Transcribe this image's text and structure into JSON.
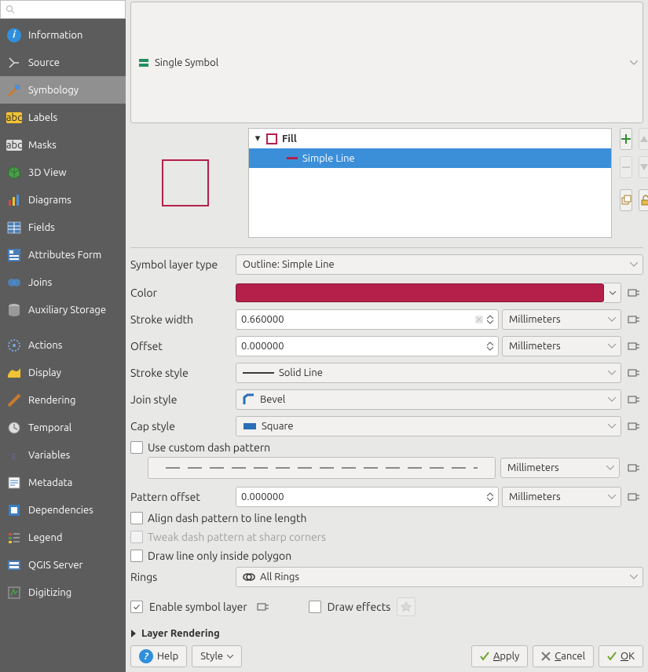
{
  "sidebar": {
    "search_placeholder": "",
    "items": [
      {
        "label": "Information",
        "icon": "info-icon",
        "selected": false
      },
      {
        "label": "Source",
        "icon": "source-icon",
        "selected": false
      },
      {
        "label": "Symbology",
        "icon": "symbology-icon",
        "selected": true
      },
      {
        "label": "Labels",
        "icon": "labels-icon",
        "selected": false
      },
      {
        "label": "Masks",
        "icon": "masks-icon",
        "selected": false
      },
      {
        "label": "3D View",
        "icon": "3d-view-icon",
        "selected": false
      },
      {
        "label": "Diagrams",
        "icon": "diagrams-icon",
        "selected": false
      },
      {
        "label": "Fields",
        "icon": "fields-icon",
        "selected": false
      },
      {
        "label": "Attributes Form",
        "icon": "attributes-form-icon",
        "selected": false
      },
      {
        "label": "Joins",
        "icon": "joins-icon",
        "selected": false
      },
      {
        "label": "Auxiliary Storage",
        "icon": "auxiliary-storage-icon",
        "selected": false
      },
      {
        "label": "",
        "icon": "",
        "gap": true
      },
      {
        "label": "Actions",
        "icon": "actions-icon",
        "selected": false
      },
      {
        "label": "Display",
        "icon": "display-icon",
        "selected": false
      },
      {
        "label": "Rendering",
        "icon": "rendering-icon",
        "selected": false
      },
      {
        "label": "Temporal",
        "icon": "temporal-icon",
        "selected": false
      },
      {
        "label": "Variables",
        "icon": "variables-icon",
        "selected": false
      },
      {
        "label": "Metadata",
        "icon": "metadata-icon",
        "selected": false
      },
      {
        "label": "Dependencies",
        "icon": "dependencies-icon",
        "selected": false
      },
      {
        "label": "Legend",
        "icon": "legend-icon",
        "selected": false
      },
      {
        "label": "QGIS Server",
        "icon": "qgis-server-icon",
        "selected": false
      },
      {
        "label": "Digitizing",
        "icon": "digitizing-icon",
        "selected": false
      }
    ]
  },
  "renderer_combo": "Single Symbol",
  "tree": {
    "fill_label": "Fill",
    "child_label": "Simple Line"
  },
  "symbol_layer_type": {
    "label": "Symbol layer type",
    "value": "Outline: Simple Line"
  },
  "color": {
    "label": "Color",
    "hex": "#b4204a"
  },
  "stroke_width": {
    "label": "Stroke width",
    "value": "0.660000",
    "unit": "Millimeters"
  },
  "offset": {
    "label": "Offset",
    "value": "0.000000",
    "unit": "Millimeters"
  },
  "stroke_style": {
    "label": "Stroke style",
    "value": "Solid Line"
  },
  "join_style": {
    "label": "Join style",
    "value": "Bevel"
  },
  "cap_style": {
    "label": "Cap style",
    "value": "Square"
  },
  "custom_dash": {
    "label": "Use custom dash pattern",
    "checked": false,
    "unit": "Millimeters"
  },
  "pattern_offset": {
    "label": "Pattern offset",
    "value": "0.000000",
    "unit": "Millimeters"
  },
  "align_dash": {
    "label": "Align dash pattern to line length",
    "checked": false
  },
  "tweak_dash": {
    "label": "Tweak dash pattern at sharp corners",
    "checked": false,
    "disabled": true
  },
  "inside_poly": {
    "label": "Draw line only inside polygon",
    "checked": false
  },
  "rings": {
    "label": "Rings",
    "value": "All Rings"
  },
  "enable_layer": {
    "label": "Enable symbol layer",
    "checked": true
  },
  "draw_effects": {
    "label": "Draw effects",
    "checked": false
  },
  "layer_rendering_section": "Layer Rendering",
  "buttons": {
    "help": "Help",
    "style": "Style",
    "apply": "Apply",
    "cancel": "Cancel",
    "ok": "OK"
  }
}
